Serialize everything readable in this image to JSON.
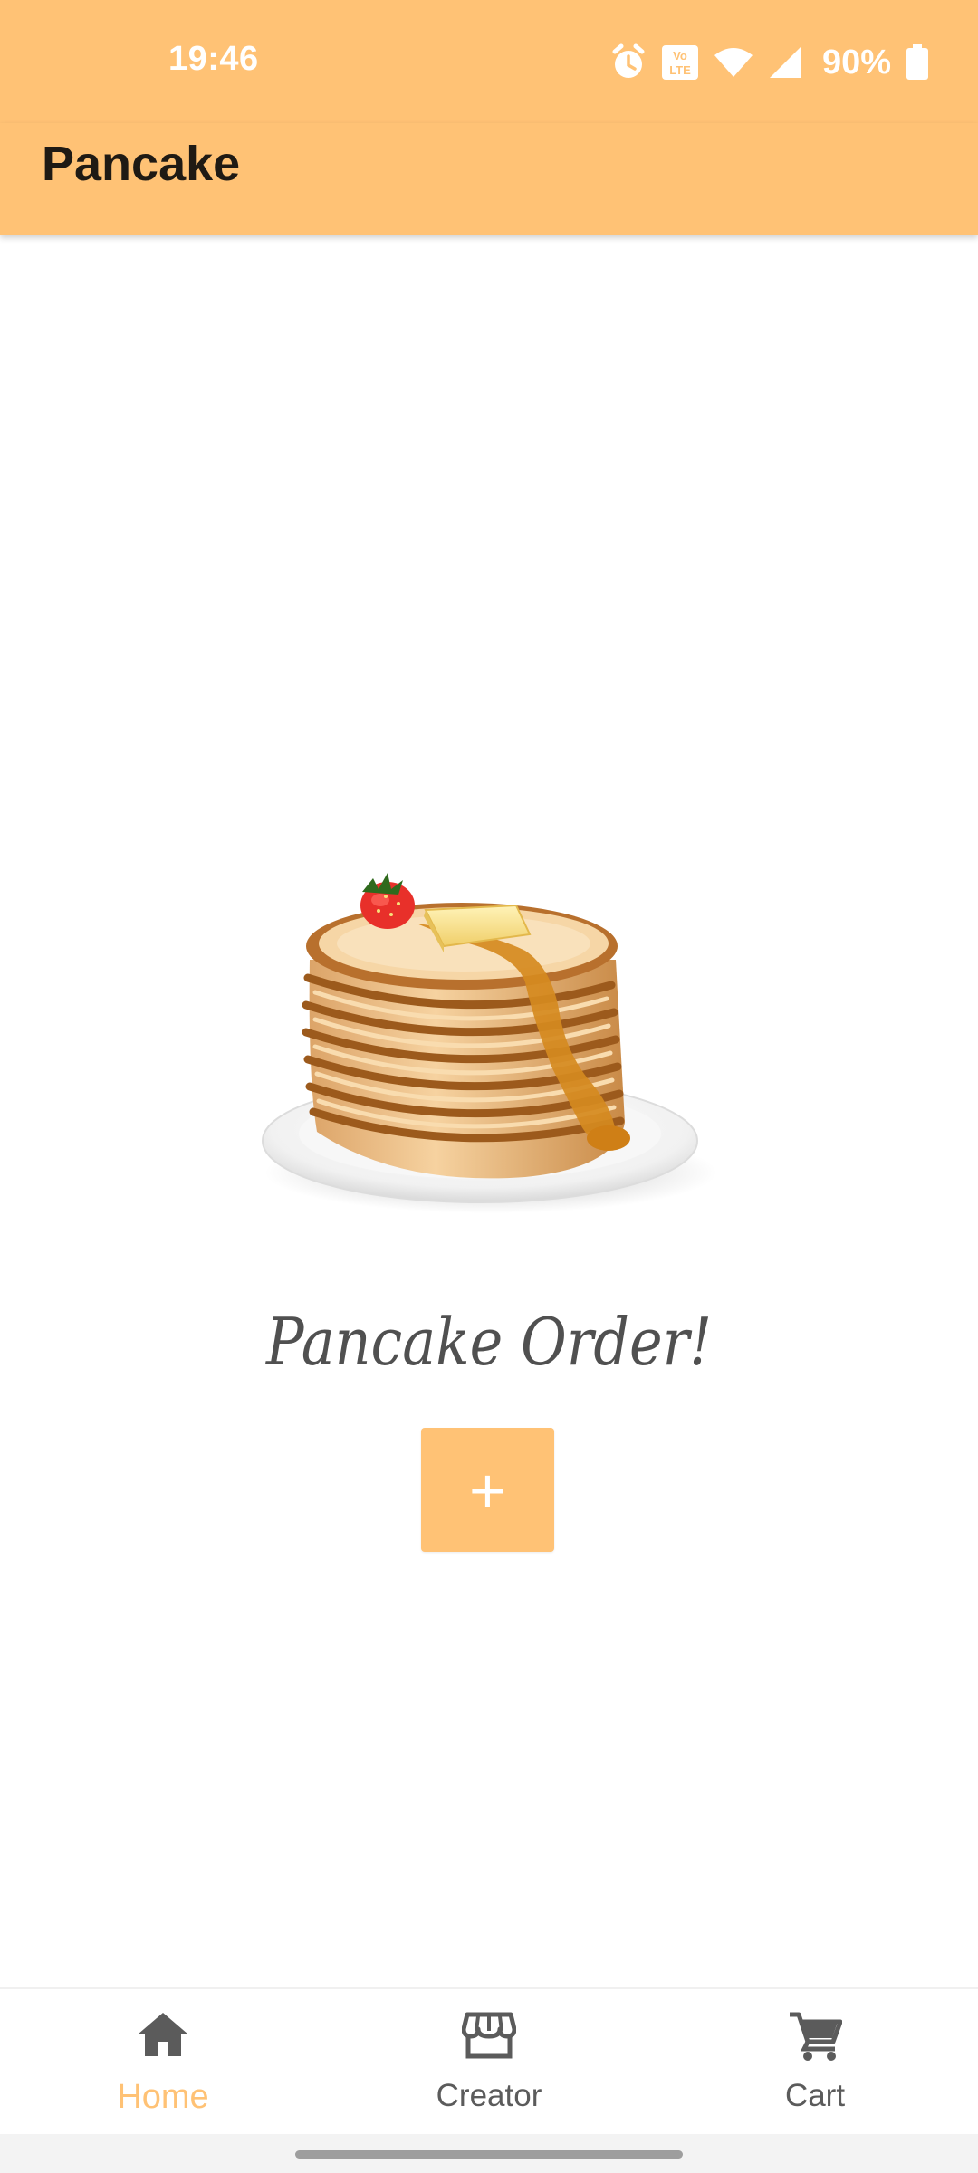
{
  "status_bar": {
    "time": "19:46",
    "battery_percent": "90%",
    "icons": [
      "alarm-icon",
      "volte-icon",
      "wifi-icon",
      "signal-icon",
      "battery-icon"
    ]
  },
  "app_bar": {
    "title": "Pancake"
  },
  "main": {
    "hero_image": "pancake-stack-image",
    "order_title": "Pancake Order!",
    "add_button_label": "+"
  },
  "bottom_nav": {
    "items": [
      {
        "label": "Home",
        "icon": "home-icon",
        "active": true
      },
      {
        "label": "Creator",
        "icon": "storefront-icon",
        "active": false
      },
      {
        "label": "Cart",
        "icon": "cart-icon",
        "active": false
      }
    ]
  },
  "colors": {
    "primary": "#ffc275",
    "text_dark": "#1f1a14",
    "nav_inactive": "#5b5b5b",
    "nav_active": "#ffc275"
  }
}
